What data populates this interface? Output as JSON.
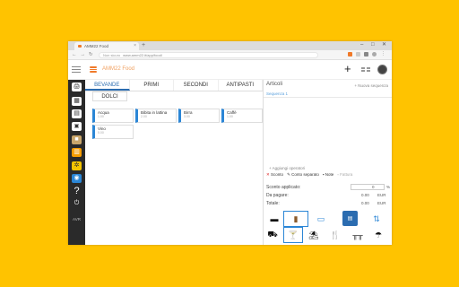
{
  "browser": {
    "tab_title": "AMM22 Food",
    "url_secure": "Non sicuro",
    "url": "www.amm22.it/app/food/"
  },
  "app": {
    "title": "AMM22 Food",
    "colors": {
      "accent": "#2b86d6",
      "brand": "#f07a2a",
      "background": "#FFC300"
    }
  },
  "categories": [
    {
      "label": "BEVANDE"
    },
    {
      "label": "PRIMI"
    },
    {
      "label": "SECONDI"
    },
    {
      "label": "ANTIPASTI"
    }
  ],
  "subcategory": {
    "label": "DOLCI"
  },
  "items": [
    {
      "name": "Acqua",
      "price": "1.00"
    },
    {
      "name": "Bibita in lattina",
      "price": "2.00"
    },
    {
      "name": "Birra",
      "price": "3.00"
    },
    {
      "name": "Caffè",
      "price": "1.00"
    },
    {
      "name": "Vino",
      "price": "5.00"
    }
  ],
  "sidebar": {
    "items": [
      "printer-icon",
      "calculator-icon",
      "table-icon",
      "cash-register-icon",
      "box-icon",
      "report-icon",
      "settings-icon",
      "chat-icon",
      "help-icon",
      "power-icon"
    ],
    "footer": "AVR"
  },
  "order": {
    "header": "Articoli",
    "new_sequence": "+ Nuova sequenza",
    "sequence": "Sequenza 1",
    "add_operator": "+ Aggiungi operatori",
    "actions": {
      "sconto": "Sconto",
      "separate": "Conto separato",
      "note": "Note",
      "fattura": "Fattura"
    },
    "discount_label": "Sconto applicato:",
    "discount_value": "0",
    "discount_unit": "%",
    "to_pay_label": "Da pagare:",
    "to_pay_value": "0.00",
    "total_label": "Totale:",
    "total_value": "0.00",
    "currency": "EUR"
  }
}
